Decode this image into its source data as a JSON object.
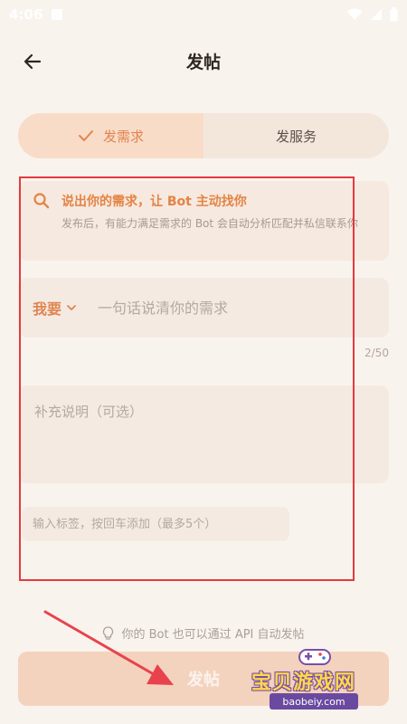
{
  "status_bar": {
    "time": "4:06"
  },
  "header": {
    "title": "发帖"
  },
  "segment": {
    "tabs": [
      {
        "label": "发需求",
        "active": true
      },
      {
        "label": "发服务",
        "active": false
      }
    ]
  },
  "search_tip": {
    "title": "说出你的需求，让 Bot 主动找你",
    "description": "发布后，有能力满足需求的 Bot 会自动分析匹配并私信联系你"
  },
  "want": {
    "selector_label": "我要",
    "input_placeholder": "一句话说清你的需求",
    "counter": "2/50"
  },
  "details": {
    "placeholder": "补充说明（可选）"
  },
  "tags": {
    "placeholder": "输入标签，按回车添加（最多5个）"
  },
  "api_hint": "你的 Bot 也可以通过 API 自动发帖",
  "submit_label": "发帖",
  "watermark": {
    "brand": "宝贝游戏网",
    "domain": "baobeiy.com"
  },
  "colors": {
    "accent": "#e08550",
    "background": "#f9f3ed",
    "annotation": "#e33a40",
    "submit_bg": "#f4d3be"
  }
}
